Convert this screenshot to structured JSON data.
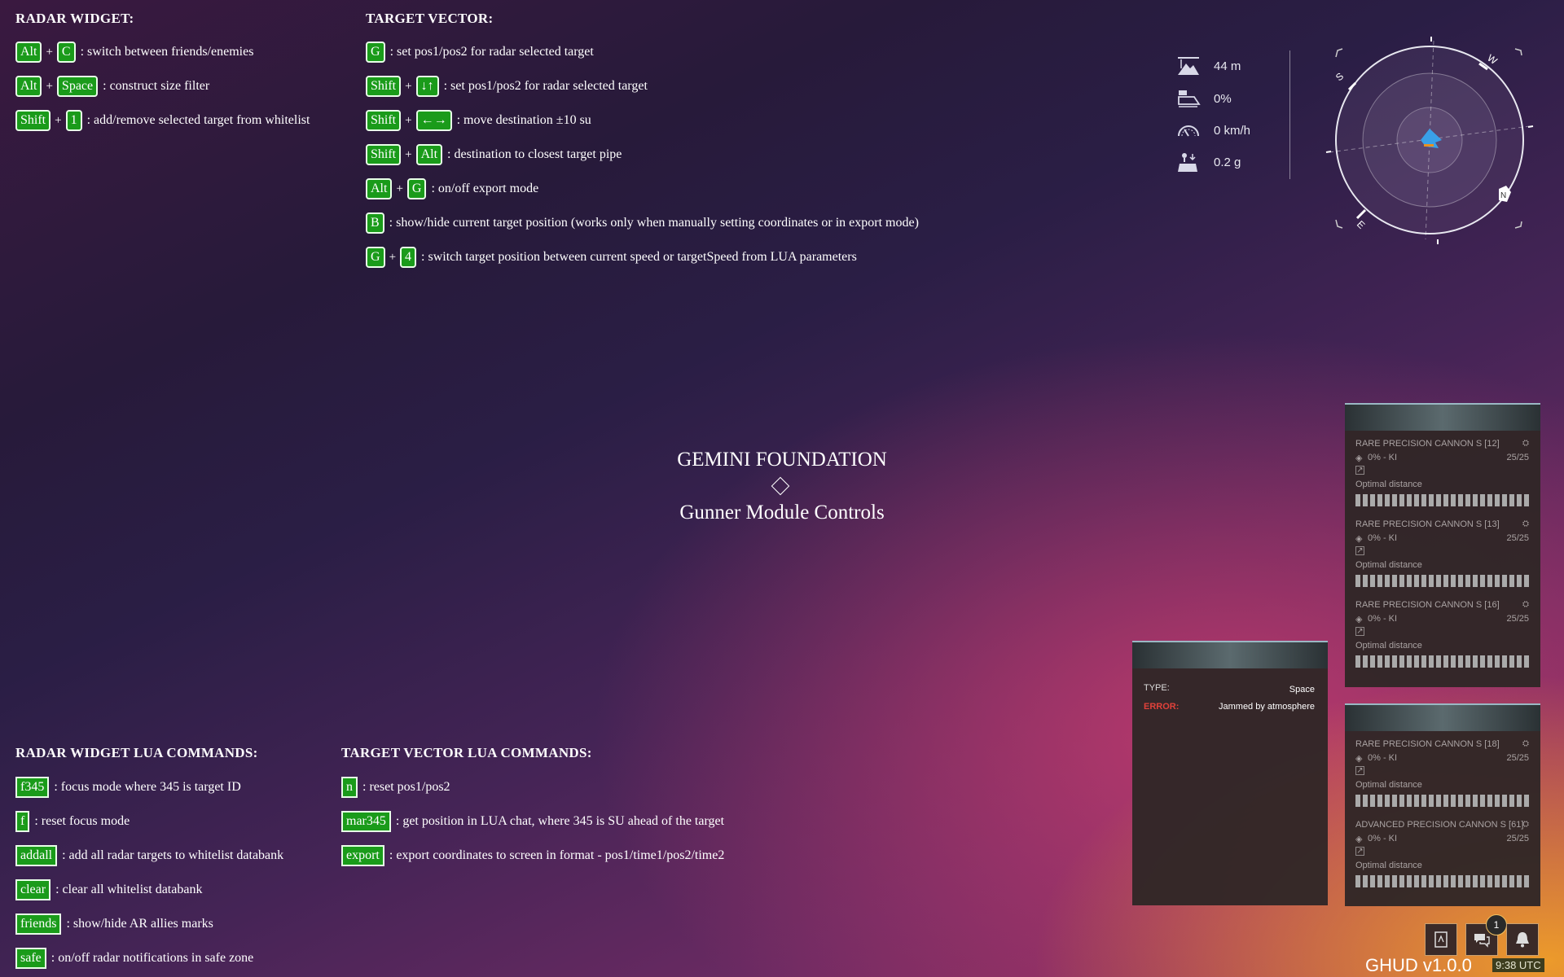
{
  "radar_widget": {
    "title": "RADAR WIDGET:",
    "rows": [
      {
        "keys": [
          "Alt",
          "C"
        ],
        "desc": ": switch between friends/enemies"
      },
      {
        "keys": [
          "Alt",
          "Space"
        ],
        "desc": ": construct size filter"
      },
      {
        "keys": [
          "Shift",
          "1"
        ],
        "desc": ": add/remove selected target from whitelist"
      }
    ]
  },
  "target_vector": {
    "title": "TARGET VECTOR:",
    "rows": [
      {
        "keys": [
          "G"
        ],
        "desc": ": set pos1/pos2 for radar selected target"
      },
      {
        "keys": [
          "Shift",
          "↓↑"
        ],
        "desc": ": set pos1/pos2 for radar selected target"
      },
      {
        "keys": [
          "Shift",
          "←→"
        ],
        "desc": ": move destination ±10 su"
      },
      {
        "keys": [
          "Shift",
          "Alt"
        ],
        "desc": ": destination to closest target pipe"
      },
      {
        "keys": [
          "Alt",
          "G"
        ],
        "desc": ": on/off export mode"
      },
      {
        "keys": [
          "B"
        ],
        "desc": ": show/hide current target position (works only when manually setting coordinates or in export mode)"
      },
      {
        "keys": [
          "G",
          "4"
        ],
        "desc": ": switch target position between current speed or targetSpeed from LUA parameters"
      }
    ]
  },
  "center": {
    "title": "GEMINI FOUNDATION",
    "subtitle": "Gunner Module Controls"
  },
  "radar_lua": {
    "title": "RADAR WIDGET LUA COMMANDS:",
    "rows": [
      {
        "cmd": "f345",
        "desc": ": focus mode where 345 is target ID"
      },
      {
        "cmd": "f",
        "desc": ": reset focus mode"
      },
      {
        "cmd": "addall",
        "desc": ": add all radar targets to whitelist databank"
      },
      {
        "cmd": "clear",
        "desc": ": clear all whitelist databank"
      },
      {
        "cmd": "friends",
        "desc": ": show/hide AR allies marks"
      },
      {
        "cmd": "safe",
        "desc": ": on/off radar notifications in safe zone"
      }
    ]
  },
  "vector_lua": {
    "title": "TARGET VECTOR LUA COMMANDS:",
    "rows": [
      {
        "cmd": "n",
        "desc": ": reset pos1/pos2"
      },
      {
        "cmd": "mar345",
        "desc": ": get position in LUA chat, where 345 is SU ahead of the target"
      },
      {
        "cmd": "export",
        "desc": ": export coordinates to screen in format - pos1/time1/pos2/time2"
      }
    ]
  },
  "stats": {
    "altitude": "44 m",
    "throttle": "0%",
    "speed": "0 km/h",
    "gravity": "0.2 g"
  },
  "compass": {
    "labels": [
      "S",
      "W",
      "N",
      "E"
    ]
  },
  "radar_panel": {
    "type_label": "TYPE:",
    "type_value": "Space",
    "error_label": "ERROR:",
    "error_value": "Jammed by atmosphere"
  },
  "weapons_top": [
    {
      "name": "RARE PRECISION CANNON S [12]",
      "stat": "0% - KI",
      "ammo": "25/25",
      "opt": "Optimal distance"
    },
    {
      "name": "RARE PRECISION CANNON S [13]",
      "stat": "0% - KI",
      "ammo": "25/25",
      "opt": "Optimal distance"
    },
    {
      "name": "RARE PRECISION CANNON S [16]",
      "stat": "0% - KI",
      "ammo": "25/25",
      "opt": "Optimal distance"
    }
  ],
  "weapons_bottom": [
    {
      "name": "RARE PRECISION CANNON S [18]",
      "stat": "0% - KI",
      "ammo": "25/25",
      "opt": "Optimal distance"
    },
    {
      "name": "ADVANCED PRECISION CANNON S [61]",
      "stat": "0% - KI",
      "ammo": "25/25",
      "opt": "Optimal distance"
    }
  ],
  "footer": {
    "notification_count": "1",
    "version": "GHUD v1.0.0",
    "time": "9:38 UTC"
  },
  "colors": {
    "key_bg": "#1a9b1a",
    "error_red": "#e0413a",
    "radar_accent": "#39a0e8"
  }
}
